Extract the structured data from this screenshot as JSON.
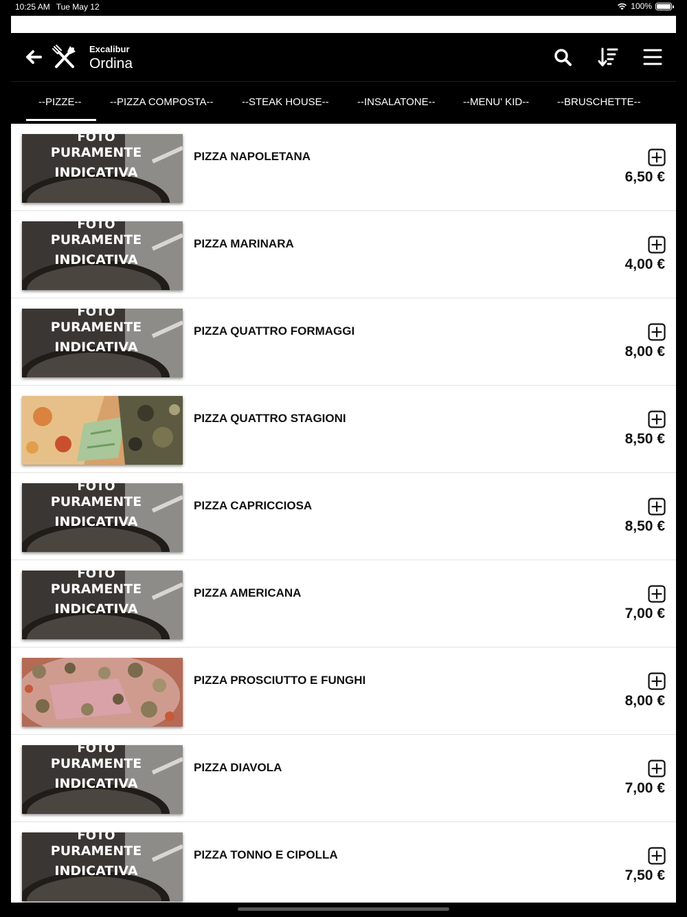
{
  "status": {
    "time": "10:25 AM",
    "date": "Tue May 12",
    "battery": "100%",
    "battery_level": 1.0
  },
  "header": {
    "app_name": "Excalibur",
    "page_title": "Ordina",
    "icons": {
      "back": "back-arrow-icon",
      "logo": "fork-knife-icon",
      "search": "search-icon",
      "sort": "sort-icon",
      "menu": "hamburger-menu-icon"
    }
  },
  "tabs": [
    {
      "label": "--PIZZE--",
      "active": true
    },
    {
      "label": "--PIZZA COMPOSTA--",
      "active": false
    },
    {
      "label": "--STEAK HOUSE--",
      "active": false
    },
    {
      "label": "--INSALATONE--",
      "active": false
    },
    {
      "label": "--MENU' KID--",
      "active": false
    },
    {
      "label": "--BRUSCHETTE--",
      "active": false
    }
  ],
  "placeholder_image_text": {
    "top": "FOTO",
    "line1": "PURAMENTE",
    "line2": "INDICATIVA"
  },
  "items": [
    {
      "name": "PIZZA NAPOLETANA",
      "price": "6,50 €",
      "image": "placeholder"
    },
    {
      "name": "PIZZA MARINARA",
      "price": "4,00 €",
      "image": "placeholder"
    },
    {
      "name": "PIZZA QUATTRO FORMAGGI",
      "price": "8,00 €",
      "image": "placeholder"
    },
    {
      "name": "PIZZA QUATTRO STAGIONI",
      "price": "8,50 €",
      "image": "pizza-quattro-stagioni-photo"
    },
    {
      "name": "PIZZA CAPRICCIOSA",
      "price": "8,50 €",
      "image": "placeholder"
    },
    {
      "name": "PIZZA AMERICANA",
      "price": "7,00 €",
      "image": "placeholder"
    },
    {
      "name": "PIZZA PROSCIUTTO E FUNGHI",
      "price": "8,00 €",
      "image": "pizza-prosciutto-funghi-photo"
    },
    {
      "name": "PIZZA DIAVOLA",
      "price": "7,00 €",
      "image": "placeholder"
    },
    {
      "name": "PIZZA TONNO E CIPOLLA",
      "price": "7,50 €",
      "image": "placeholder"
    }
  ],
  "colors": {
    "header_bg": "#000000",
    "list_bg": "#ffffff",
    "text": "#111111",
    "divider": "#e2e2e2"
  }
}
